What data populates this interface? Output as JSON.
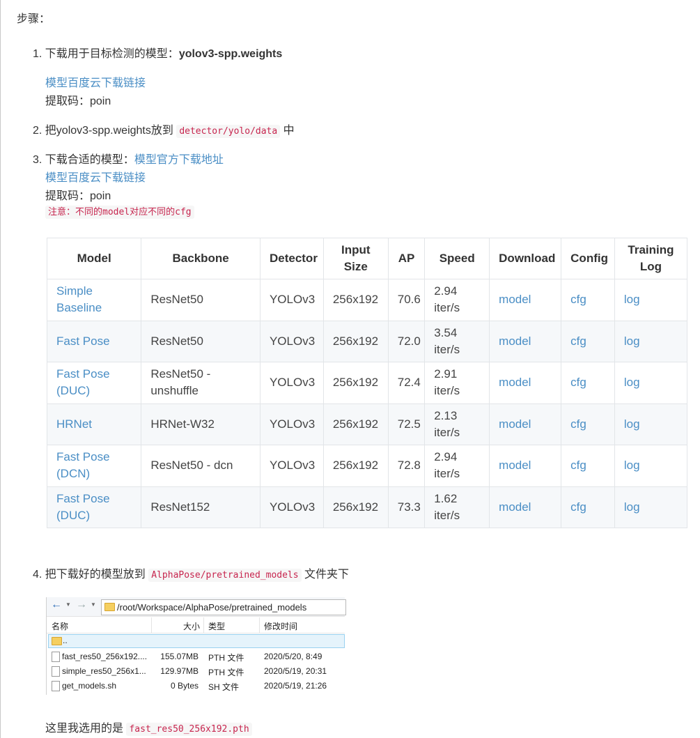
{
  "heading": "步骤：",
  "step1": {
    "num": "1.",
    "text": "下载用于目标检测的模型：",
    "bold": "yolov3-spp.weights",
    "link": "模型百度云下载链接",
    "code": "提取码：poin"
  },
  "step2": {
    "num": "2.",
    "text1": "把yolov3-spp.weights放到",
    "code": "detector/yolo/data",
    "text2": "中"
  },
  "step3": {
    "num": "3.",
    "text": "下载合适的模型：",
    "link1": "模型官方下载地址",
    "link2": "模型百度云下载链接",
    "code": "提取码：poin",
    "note": "注意：不同的model对应不同的cfg"
  },
  "table": {
    "headers": [
      "Model",
      "Backbone",
      "Detector",
      "Input Size",
      "AP",
      "Speed",
      "Download",
      "Config",
      "Training Log"
    ],
    "rows": [
      [
        "Simple Baseline",
        "ResNet50",
        "YOLOv3",
        "256x192",
        "70.6",
        "2.94 iter/s",
        "model",
        "cfg",
        "log"
      ],
      [
        "Fast Pose",
        "ResNet50",
        "YOLOv3",
        "256x192",
        "72.0",
        "3.54 iter/s",
        "model",
        "cfg",
        "log"
      ],
      [
        "Fast Pose (DUC)",
        "ResNet50 - unshuffle",
        "YOLOv3",
        "256x192",
        "72.4",
        "2.91 iter/s",
        "model",
        "cfg",
        "log"
      ],
      [
        "HRNet",
        "HRNet-W32",
        "YOLOv3",
        "256x192",
        "72.5",
        "2.13 iter/s",
        "model",
        "cfg",
        "log"
      ],
      [
        "Fast Pose (DCN)",
        "ResNet50 - dcn",
        "YOLOv3",
        "256x192",
        "72.8",
        "2.94 iter/s",
        "model",
        "cfg",
        "log"
      ],
      [
        "Fast Pose (DUC)",
        "ResNet152",
        "YOLOv3",
        "256x192",
        "73.3",
        "1.62 iter/s",
        "model",
        "cfg",
        "log"
      ]
    ]
  },
  "step4": {
    "num": "4.",
    "text1": "把下载好的模型放到",
    "code": "AlphaPose/pretrained_models",
    "text2": "文件夹下"
  },
  "explorer": {
    "path": "/root/Workspace/AlphaPose/pretrained_models",
    "headers": {
      "name": "名称",
      "size": "大小",
      "type": "类型",
      "modified": "修改时间"
    },
    "parent": "..",
    "files": [
      {
        "name": "fast_res50_256x192....",
        "size": "155.07MB",
        "type": "PTH 文件",
        "modified": "2020/5/20, 8:49"
      },
      {
        "name": "simple_res50_256x1...",
        "size": "129.97MB",
        "type": "PTH 文件",
        "modified": "2020/5/19, 20:31"
      },
      {
        "name": "get_models.sh",
        "size": "0 Bytes",
        "type": "SH 文件",
        "modified": "2020/5/19, 21:26"
      }
    ]
  },
  "footer": {
    "text": "这里我选用的是",
    "code": "fast_res50_256x192.pth"
  },
  "colors": {
    "link": "#4a8ec5",
    "code_text": "#c7254e",
    "code_bg": "#f6f6f6"
  }
}
